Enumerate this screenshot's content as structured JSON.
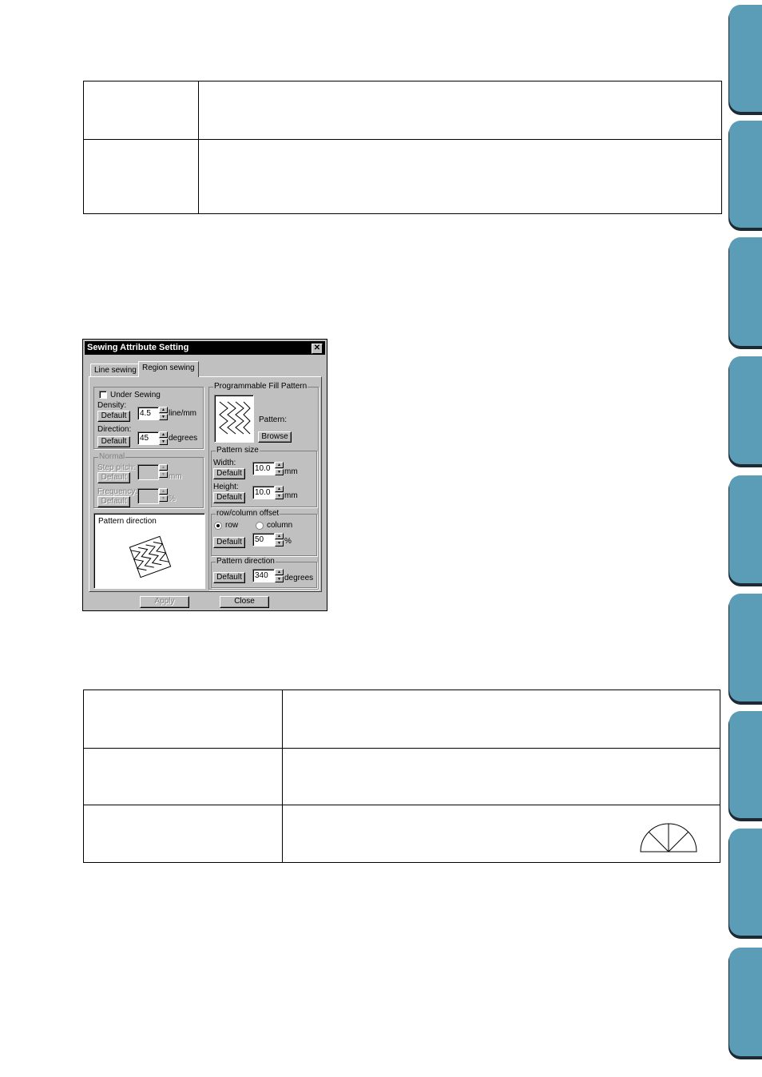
{
  "dialog": {
    "title": "Sewing Attribute Setting",
    "close_glyph": "✕",
    "tabs": [
      {
        "label": "Line sewing"
      },
      {
        "label": "Region sewing"
      }
    ],
    "under_sewing": {
      "label": "Under Sewing",
      "checked": false
    },
    "density": {
      "label": "Density:",
      "default_label": "Default",
      "value": "4.5",
      "unit": "line/mm"
    },
    "direction": {
      "label": "Direction:",
      "default_label": "Default",
      "value": "45",
      "unit": "degrees"
    },
    "normal": {
      "group_label": "Normal",
      "step_pitch": {
        "label": "Step pitch:",
        "default_label": "Default",
        "unit": "mm"
      },
      "frequency": {
        "label": "Frequency:",
        "default_label": "Default",
        "unit": "%"
      }
    },
    "preview": {
      "label": "Pattern direction"
    },
    "programmable": {
      "group_label": "Programmable Fill Pattern",
      "pattern_label": "Pattern:",
      "browse_label": "Browse"
    },
    "pattern_size": {
      "group_label": "Pattern size",
      "width": {
        "label": "Width:",
        "default_label": "Default",
        "value": "10.0",
        "unit": "mm"
      },
      "height": {
        "label": "Height:",
        "default_label": "Default",
        "value": "10.0",
        "unit": "mm"
      }
    },
    "offset": {
      "group_label": "row/column offset",
      "row_label": "row",
      "column_label": "column",
      "selected": "row",
      "default_label": "Default",
      "value": "50",
      "unit": "%"
    },
    "pattern_direction": {
      "group_label": "Pattern direction",
      "default_label": "Default",
      "value": "340",
      "unit": "degrees"
    },
    "apply_label": "Apply",
    "close_label": "Close"
  },
  "colors": {
    "side_tab": "#5b9db7",
    "side_tab_shadow": "#1e2a33",
    "dialog_face": "#c0c0c0",
    "titlebar": "#000000"
  }
}
